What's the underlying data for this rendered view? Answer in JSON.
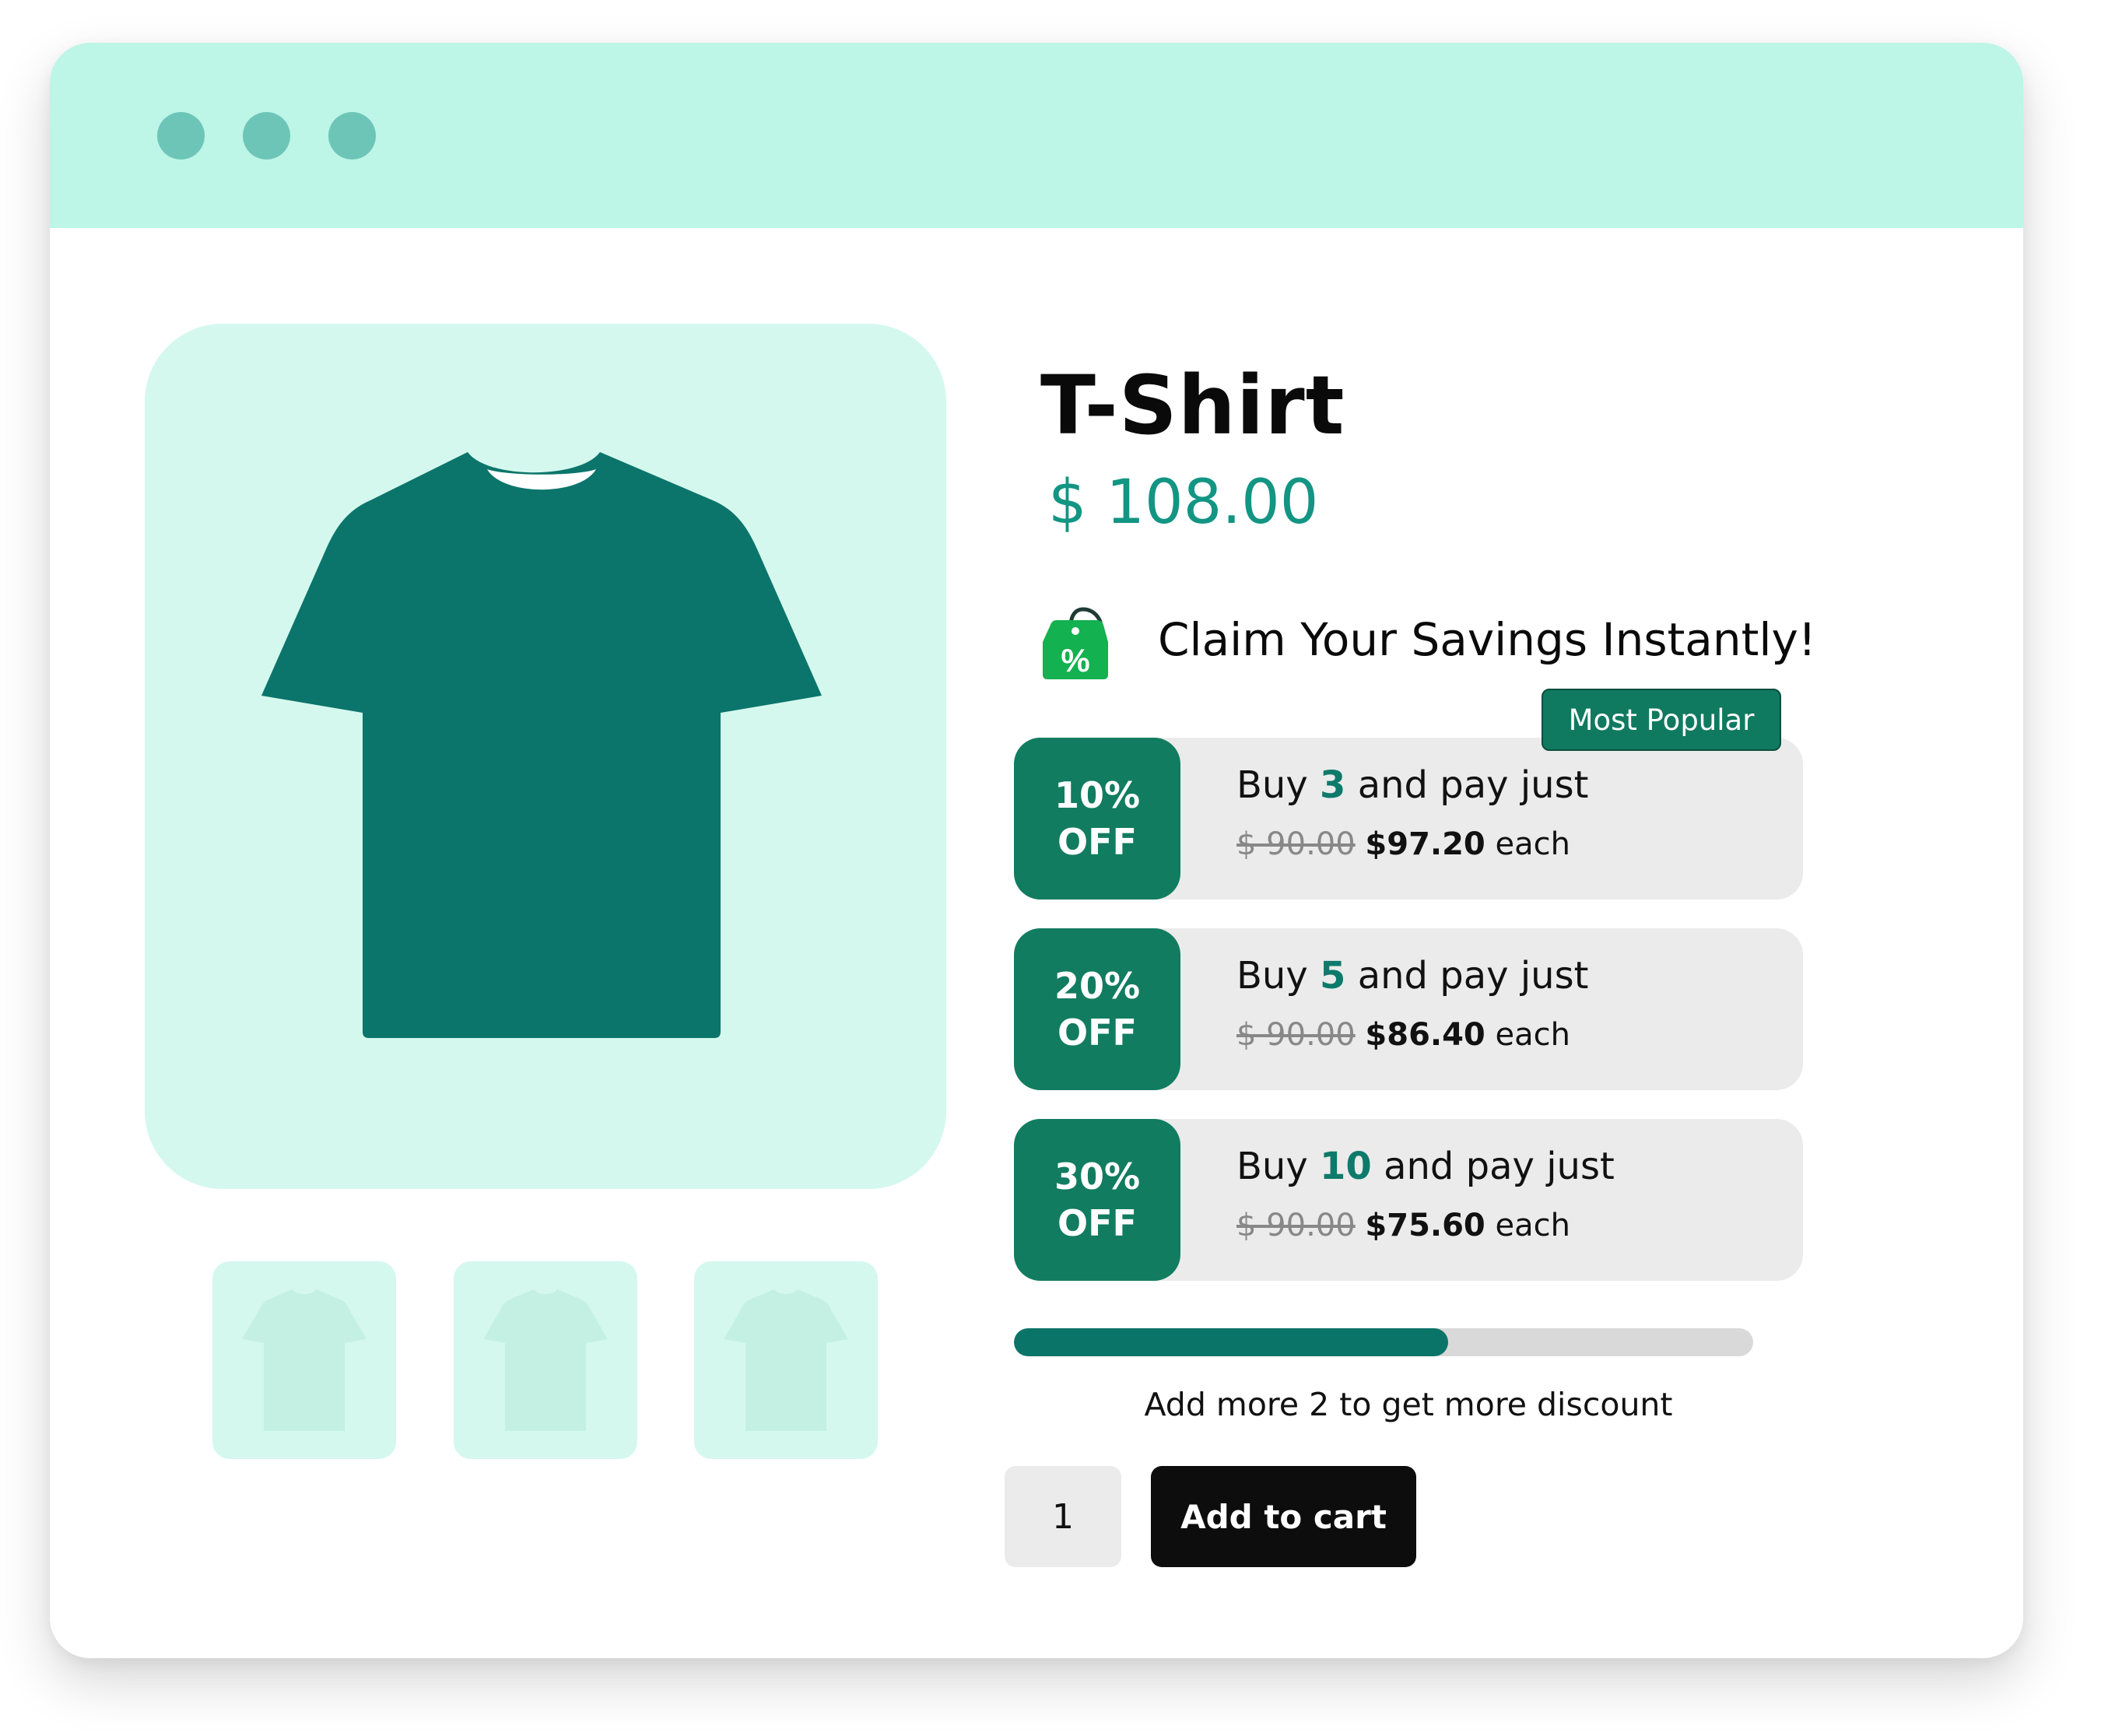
{
  "window": {
    "traffic_lights": [
      "dot",
      "dot",
      "dot"
    ]
  },
  "product": {
    "title": "T-Shirt",
    "price": "$ 108.00",
    "image_icon": "t-shirt-icon",
    "thumbnails": [
      "t-shirt-icon",
      "t-shirt-icon",
      "t-shirt-icon"
    ]
  },
  "savings": {
    "icon": "discount-tag-icon",
    "heading": "Claim Your Savings Instantly!",
    "popular_badge": "Most Popular",
    "offers": [
      {
        "percent": "10%",
        "off": "OFF",
        "buy": "Buy",
        "qty": "3",
        "rest": "and pay just",
        "old_price": "$ 90.00",
        "new_price": "$97.20",
        "each": "each"
      },
      {
        "percent": "20%",
        "off": "OFF",
        "buy": "Buy",
        "qty": "5",
        "rest": "and pay just",
        "old_price": "$ 90.00",
        "new_price": "$86.40",
        "each": "each"
      },
      {
        "percent": "30%",
        "off": "OFF",
        "buy": "Buy",
        "qty": "10",
        "rest": "and pay just",
        "old_price": "$ 90.00",
        "new_price": "$75.60",
        "each": "each"
      }
    ]
  },
  "progress": {
    "fraction": 0.587,
    "text": "Add more 2 to get more discount"
  },
  "cart": {
    "quantity": "1",
    "button_label": "Add to cart"
  },
  "colors": {
    "titlebar": "#bdf5e6",
    "accent": "#117c60",
    "price": "#139583",
    "shirt": "#0b756b",
    "image_bg": "#d5f8ee"
  }
}
